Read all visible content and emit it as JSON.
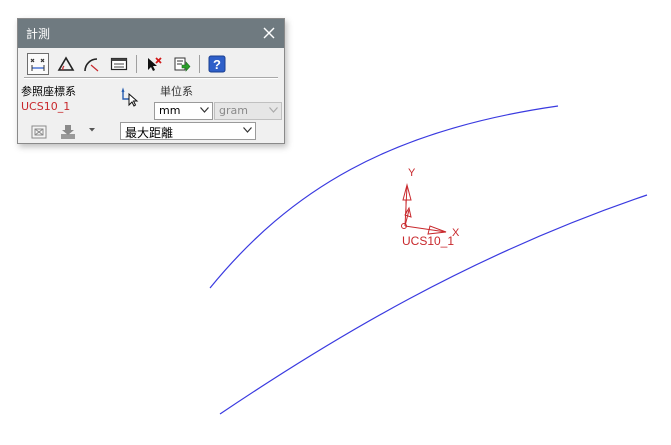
{
  "panel": {
    "title": "計測",
    "toolbar": {
      "buttons": [
        {
          "name": "distance",
          "icon": "distance-measure-icon",
          "active": true
        },
        {
          "name": "angle",
          "icon": "angle-measure-icon"
        },
        {
          "name": "arc",
          "icon": "arc-measure-icon"
        },
        {
          "name": "info",
          "icon": "info-list-icon"
        },
        {
          "name": "clear",
          "icon": "clear-selection-icon"
        },
        {
          "name": "export",
          "icon": "export-icon"
        },
        {
          "name": "help",
          "icon": "help-icon"
        }
      ]
    },
    "reference_label": "参照座標系",
    "reference_value": "UCS10_1",
    "units_label": "単位系",
    "length_unit": "mm",
    "mass_unit": "gram",
    "mode": "最大距離"
  },
  "viewport": {
    "curve_color": "#3a3ae0",
    "ucs_color": "#c8282c",
    "axis_x_label": "X",
    "axis_y_label": "Y",
    "ucs_label": "UCS10_1"
  }
}
